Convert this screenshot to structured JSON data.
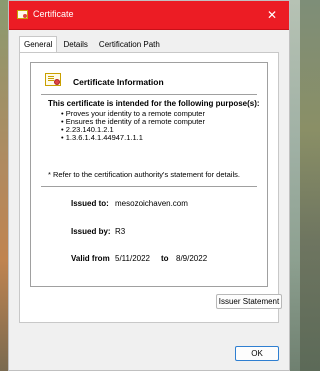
{
  "window": {
    "title": "Certificate",
    "close_glyph": "✕",
    "titlebar_color": "#ec1c24"
  },
  "tabs": [
    {
      "label": "General"
    },
    {
      "label": "Details"
    },
    {
      "label": "Certification Path"
    }
  ],
  "info": {
    "heading": "Certificate Information",
    "purpose_heading": "This certificate is intended for the following purpose(s):",
    "purposes": [
      "Proves your identity to a remote computer",
      "Ensures the identity of a remote computer",
      "2.23.140.1.2.1",
      "1.3.6.1.4.1.44947.1.1.1"
    ],
    "note": "* Refer to the certification authority's statement for details.",
    "issued_to_label": "Issued to:",
    "issued_to_value": "mesozoichaven.com",
    "issued_by_label": "Issued by:",
    "issued_by_value": "R3",
    "valid_from_label": "Valid from",
    "valid_from_value": "5/11/2022",
    "valid_to_label": "to",
    "valid_to_value": "8/9/2022"
  },
  "buttons": {
    "issuer_statement": "Issuer Statement",
    "ok": "OK"
  },
  "icons": {
    "title_icon": "certificate-icon",
    "info_icon": "certificate-icon",
    "close_icon": "close-icon"
  }
}
